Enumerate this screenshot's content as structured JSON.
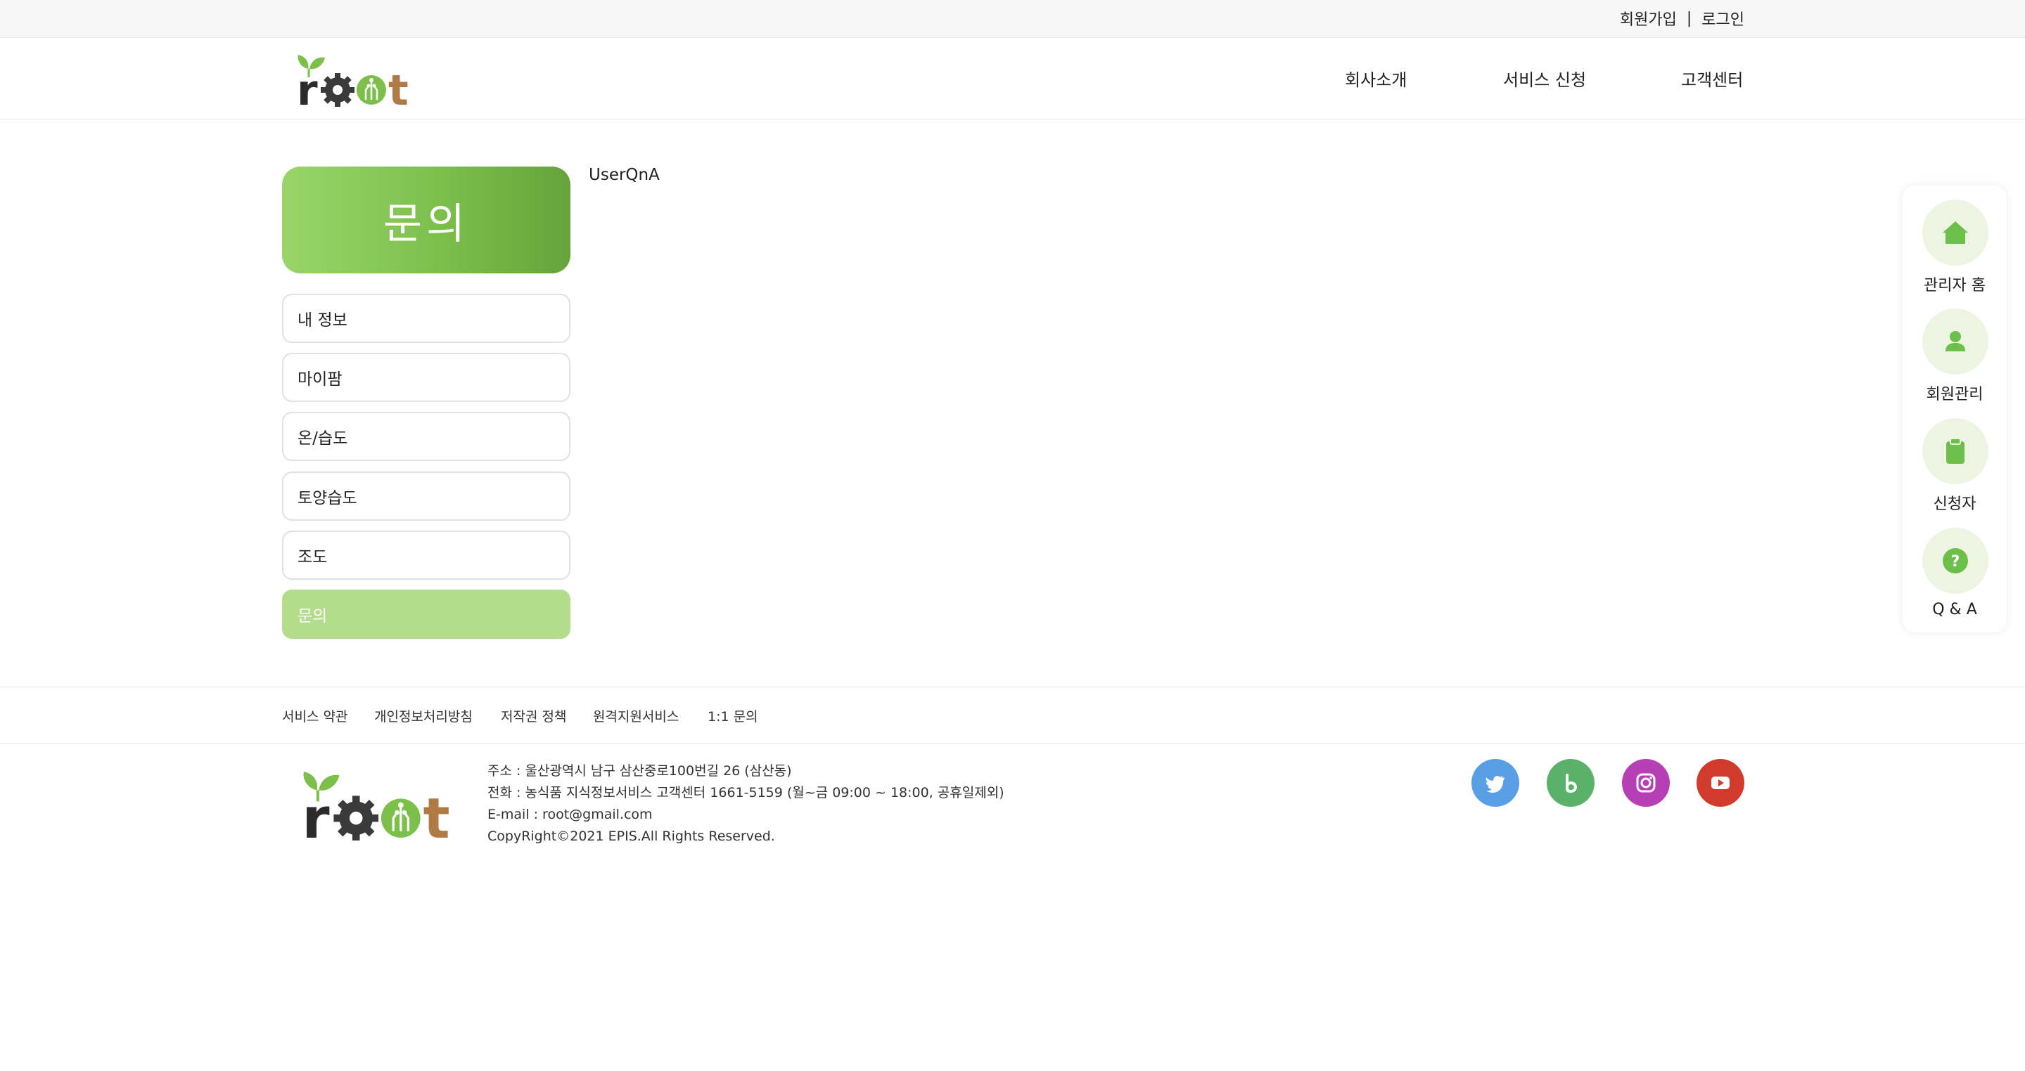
{
  "util": {
    "signup": "회원가입",
    "separator": "|",
    "login": "로그인"
  },
  "nav": {
    "about": "회사소개",
    "service": "서비스 신청",
    "support": "고객센터"
  },
  "logo": {
    "r": "r",
    "t": "t"
  },
  "sidebar": {
    "title": "문의",
    "items": [
      {
        "label": "내 정보"
      },
      {
        "label": "마이팜"
      },
      {
        "label": "온/습도"
      },
      {
        "label": "토양습도"
      },
      {
        "label": "조도"
      },
      {
        "label": "문의"
      }
    ],
    "active_index": 5
  },
  "content": {
    "title": "UserQnA"
  },
  "quick_menu": {
    "items": [
      {
        "label": "관리자 홈",
        "icon": "home-icon"
      },
      {
        "label": "회원관리",
        "icon": "user-icon"
      },
      {
        "label": "신청자",
        "icon": "clipboard-icon"
      },
      {
        "label": "Q & A",
        "icon": "question-icon"
      }
    ],
    "accent": "#6cbf4a"
  },
  "footer": {
    "links": [
      "서비스 약관",
      "개인정보처리방침",
      "저작권 정책",
      "원격지원서비스",
      "1:1 문의"
    ],
    "address": "주소 : 울산광역시 남구 삼산중로100번길 26 (삼산동)",
    "phone": "전화 : 농식품 지식정보서비스 고객센터 1661-5159 (월~금 09:00 ~ 18:00, 공휴일제외)",
    "email": "E-mail : root@gmail.com",
    "copyright": "CopyRight©2021 EPIS.All Rights Reserved.",
    "social": [
      {
        "name": "twitter",
        "color": "#5a9ee6"
      },
      {
        "name": "bing",
        "color": "#5ab26a"
      },
      {
        "name": "instagram",
        "color": "#b73fb6"
      },
      {
        "name": "youtube",
        "color": "#d23a2c"
      }
    ]
  },
  "colors": {
    "brand_green": "#7cbf4b",
    "brand_brown": "#b07a45",
    "dark": "#2b2b2b"
  }
}
